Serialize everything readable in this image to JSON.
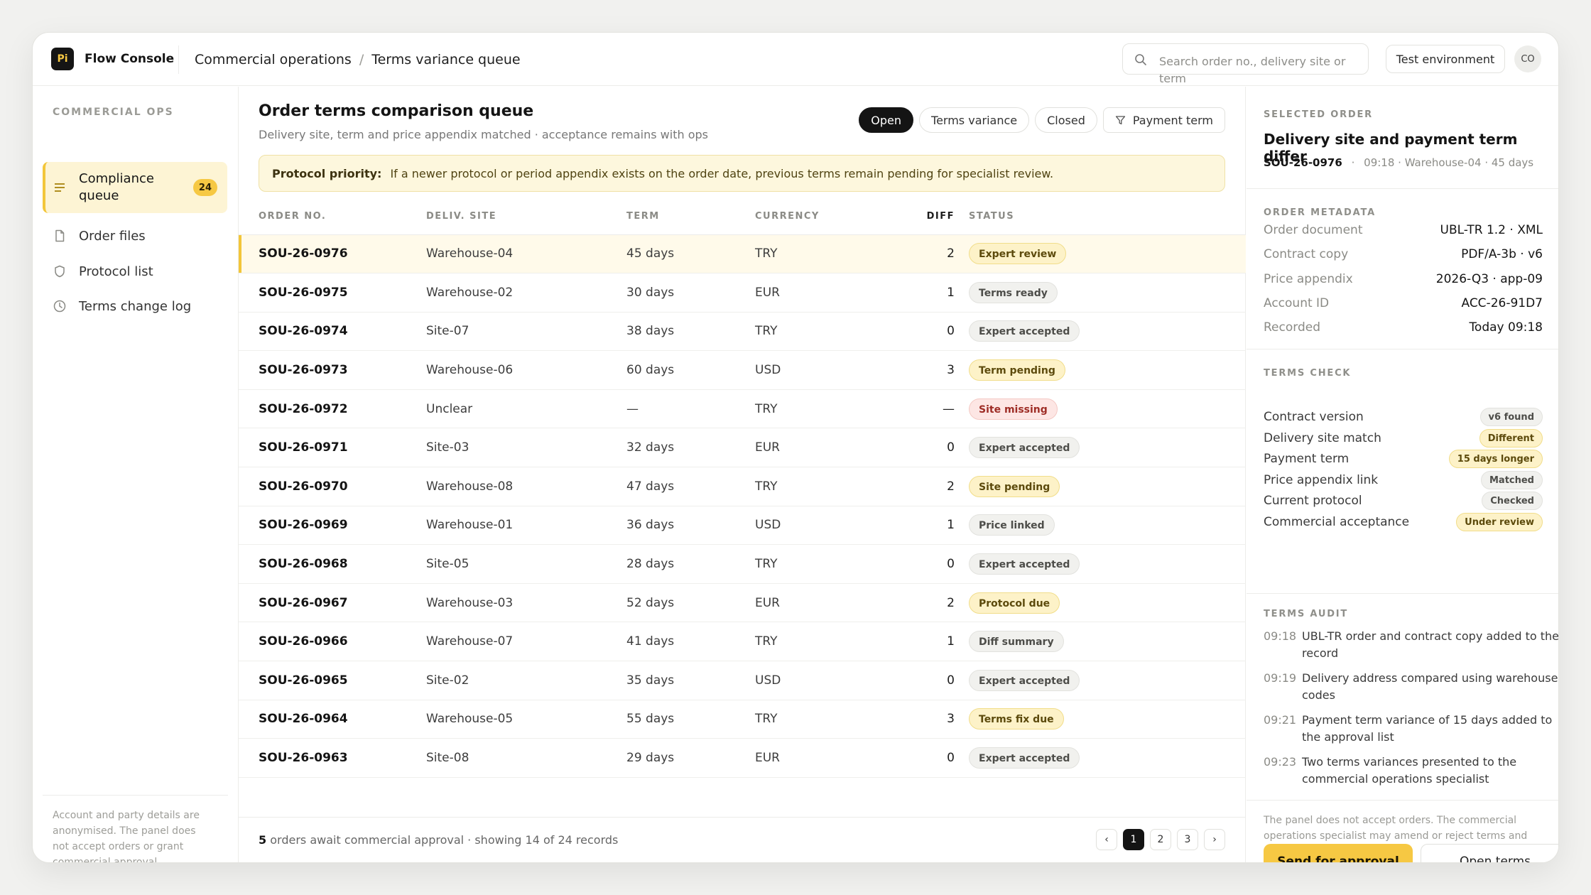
{
  "app": {
    "logo_text": "Pi",
    "name": "Flow Console"
  },
  "breadcrumb": [
    "Commercial operations",
    "Terms variance queue"
  ],
  "search": {
    "placeholder": "Search order no., delivery site or term"
  },
  "header": {
    "environment_label": "Test environment",
    "avatar_initials": "CO"
  },
  "sidebar": {
    "heading": "COMMERCIAL OPS",
    "items": [
      {
        "label": "Compliance queue",
        "icon": "list-icon",
        "badge": "24",
        "active": true
      },
      {
        "label": "Order files",
        "icon": "file-icon"
      },
      {
        "label": "Protocol list",
        "icon": "shield-icon"
      },
      {
        "label": "Terms change log",
        "icon": "clock-icon"
      }
    ],
    "footer_note": "Account and party details are anonymised. The panel does not accept orders or grant commercial approval."
  },
  "main": {
    "title": "Order terms comparison queue",
    "subtitle": "Delivery site, term and price appendix matched · acceptance remains with ops",
    "filters": [
      "Open",
      "Terms variance",
      "Closed",
      "Payment term"
    ],
    "banner": {
      "label": "Protocol priority:",
      "text": "If a newer protocol or period appendix exists on the order date, previous terms remain pending for specialist review."
    },
    "columns": [
      "ORDER NO.",
      "DELIV. SITE",
      "TERM",
      "CURRENCY",
      "DIFF",
      "STATUS"
    ],
    "rows": [
      {
        "order": "SOU-26-0976",
        "site": "Warehouse-04",
        "term": "45 days",
        "currency": "TRY",
        "diff": "2",
        "status": "Expert review",
        "tone": "yellow"
      },
      {
        "order": "SOU-26-0975",
        "site": "Warehouse-02",
        "term": "30 days",
        "currency": "EUR",
        "diff": "1",
        "status": "Terms ready",
        "tone": "gray"
      },
      {
        "order": "SOU-26-0974",
        "site": "Site-07",
        "term": "38 days",
        "currency": "TRY",
        "diff": "0",
        "status": "Expert accepted",
        "tone": "gray"
      },
      {
        "order": "SOU-26-0973",
        "site": "Warehouse-06",
        "term": "60 days",
        "currency": "USD",
        "diff": "3",
        "status": "Term pending",
        "tone": "yellow"
      },
      {
        "order": "SOU-26-0972",
        "site": "Unclear",
        "term": "—",
        "currency": "TRY",
        "diff": "—",
        "status": "Site missing",
        "tone": "red"
      },
      {
        "order": "SOU-26-0971",
        "site": "Site-03",
        "term": "32 days",
        "currency": "EUR",
        "diff": "0",
        "status": "Expert accepted",
        "tone": "gray"
      },
      {
        "order": "SOU-26-0970",
        "site": "Warehouse-08",
        "term": "47 days",
        "currency": "TRY",
        "diff": "2",
        "status": "Site pending",
        "tone": "yellow"
      },
      {
        "order": "SOU-26-0969",
        "site": "Warehouse-01",
        "term": "36 days",
        "currency": "USD",
        "diff": "1",
        "status": "Price linked",
        "tone": "gray"
      },
      {
        "order": "SOU-26-0968",
        "site": "Site-05",
        "term": "28 days",
        "currency": "TRY",
        "diff": "0",
        "status": "Expert accepted",
        "tone": "gray"
      },
      {
        "order": "SOU-26-0967",
        "site": "Warehouse-03",
        "term": "52 days",
        "currency": "EUR",
        "diff": "2",
        "status": "Protocol due",
        "tone": "yellow"
      },
      {
        "order": "SOU-26-0966",
        "site": "Warehouse-07",
        "term": "41 days",
        "currency": "TRY",
        "diff": "1",
        "status": "Diff summary",
        "tone": "gray"
      },
      {
        "order": "SOU-26-0965",
        "site": "Site-02",
        "term": "35 days",
        "currency": "USD",
        "diff": "0",
        "status": "Expert accepted",
        "tone": "gray"
      },
      {
        "order": "SOU-26-0964",
        "site": "Warehouse-05",
        "term": "55 days",
        "currency": "TRY",
        "diff": "3",
        "status": "Terms fix due",
        "tone": "yellow"
      },
      {
        "order": "SOU-26-0963",
        "site": "Site-08",
        "term": "29 days",
        "currency": "EUR",
        "diff": "0",
        "status": "Expert accepted",
        "tone": "gray"
      }
    ],
    "footer": {
      "count": "5",
      "text": "orders await commercial approval · showing 14 of 24 records"
    },
    "pagination": {
      "prev": "‹",
      "pages": [
        "1",
        "2",
        "3"
      ],
      "current": "1",
      "next": "›"
    }
  },
  "panel": {
    "selected_label": "SELECTED ORDER",
    "title": "Delivery site and payment term differ",
    "order_no": "SOU-26-0976",
    "meta": "09:18 · Warehouse-04 · 45 days",
    "metadata_label": "ORDER METADATA",
    "metadata": [
      {
        "key": "Order document",
        "value": "UBL-TR 1.2 · XML"
      },
      {
        "key": "Contract copy",
        "value": "PDF/A-3b · v6"
      },
      {
        "key": "Price appendix",
        "value": "2026-Q3 · app-09"
      },
      {
        "key": "Account ID",
        "value": "ACC-26-91D7"
      },
      {
        "key": "Recorded",
        "value": "Today 09:18"
      }
    ],
    "check_label": "TERMS CHECK",
    "checks": [
      {
        "key": "Contract version",
        "value": "v6 found",
        "tone": "gray"
      },
      {
        "key": "Delivery site match",
        "value": "Different",
        "tone": "yellow"
      },
      {
        "key": "Payment term",
        "value": "15 days longer",
        "tone": "yellow"
      },
      {
        "key": "Price appendix link",
        "value": "Matched",
        "tone": "gray"
      },
      {
        "key": "Current protocol",
        "value": "Checked",
        "tone": "gray"
      },
      {
        "key": "Commercial acceptance",
        "value": "Under review",
        "tone": "yellow"
      }
    ],
    "audit_label": "TERMS AUDIT",
    "audit": [
      {
        "time": "09:18",
        "text": "UBL-TR order and contract copy added to the record"
      },
      {
        "time": "09:19",
        "text": "Delivery address compared using warehouse codes"
      },
      {
        "time": "09:21",
        "text": "Payment term variance of 15 days added to the approval list"
      },
      {
        "time": "09:23",
        "text": "Two terms variances presented to the commercial operations specialist"
      }
    ],
    "note": "The panel does not accept orders. The commercial operations specialist may amend or reject terms and request further records.",
    "primary_button": "Send for approval",
    "secondary_button": "Open terms"
  },
  "colors": {
    "accent": "#f6c843",
    "dark": "#141414",
    "banner_bg": "#fdf7dd",
    "danger_bg": "#fde6e4"
  }
}
